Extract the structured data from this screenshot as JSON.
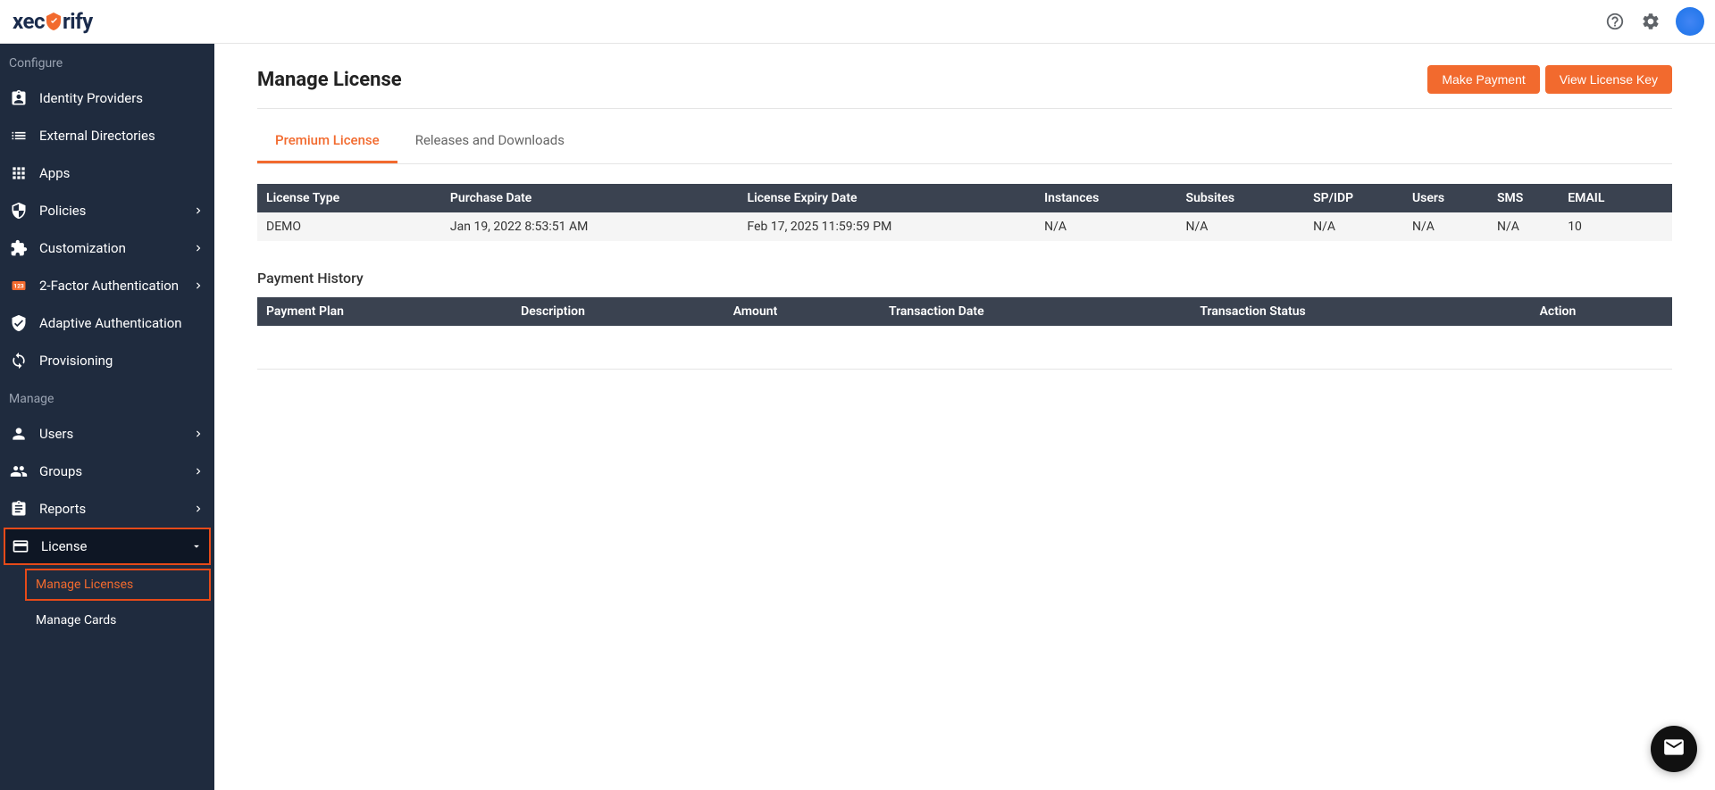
{
  "logo_text_parts": {
    "pre": "xec",
    "post": "rify"
  },
  "header": {
    "help_icon": "help",
    "settings_icon": "settings",
    "avatar": "user-avatar"
  },
  "sidebar": {
    "sections": {
      "configure": "Configure",
      "manage": "Manage"
    },
    "items": {
      "identity_providers": "Identity Providers",
      "external_directories": "External Directories",
      "apps": "Apps",
      "policies": "Policies",
      "customization": "Customization",
      "two_factor": "2-Factor Authentication",
      "adaptive_auth": "Adaptive Authentication",
      "provisioning": "Provisioning",
      "users": "Users",
      "groups": "Groups",
      "reports": "Reports",
      "license": "License",
      "manage_licenses": "Manage Licenses",
      "manage_cards": "Manage Cards"
    }
  },
  "page": {
    "title": "Manage License",
    "make_payment": "Make Payment",
    "view_license_key": "View License Key"
  },
  "tabs": {
    "premium_license": "Premium License",
    "releases_downloads": "Releases and Downloads"
  },
  "license_table": {
    "headers": {
      "license_type": "License Type",
      "purchase_date": "Purchase Date",
      "license_expiry": "License Expiry Date",
      "instances": "Instances",
      "subsites": "Subsites",
      "sp_idp": "SP/IDP",
      "users": "Users",
      "sms": "SMS",
      "email": "EMAIL"
    },
    "row": {
      "license_type": "DEMO",
      "purchase_date": "Jan 19, 2022 8:53:51 AM",
      "license_expiry": "Feb 17, 2025 11:59:59 PM",
      "instances": "N/A",
      "subsites": "N/A",
      "sp_idp": "N/A",
      "users": "N/A",
      "sms": "N/A",
      "email": "10"
    }
  },
  "payment_history": {
    "title": "Payment History",
    "headers": {
      "payment_plan": "Payment Plan",
      "description": "Description",
      "amount": "Amount",
      "transaction_date": "Transaction Date",
      "transaction_status": "Transaction Status",
      "action": "Action"
    }
  }
}
